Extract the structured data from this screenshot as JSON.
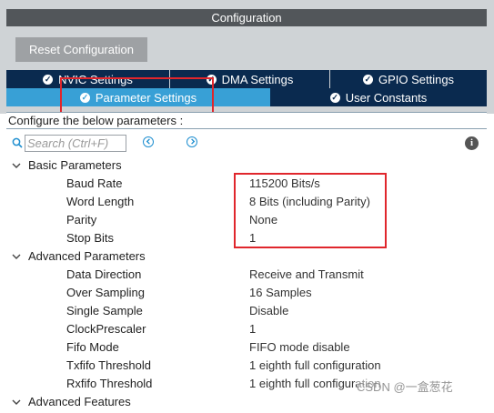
{
  "window": {
    "title": "Configuration"
  },
  "toolbar": {
    "reset_label": "Reset Configuration"
  },
  "tabs_row1": [
    {
      "label": "NVIC Settings",
      "icon": "check-circle-icon"
    },
    {
      "label": "DMA Settings",
      "icon": "check-circle-icon"
    },
    {
      "label": "GPIO Settings",
      "icon": "check-circle-icon"
    }
  ],
  "tabs_row2": [
    {
      "label": "Parameter Settings",
      "icon": "check-circle-icon",
      "active": true
    },
    {
      "label": "User Constants",
      "icon": "check-circle-icon",
      "active": false
    }
  ],
  "subtitle": "Configure the below parameters :",
  "search": {
    "placeholder": "Search (Ctrl+F)",
    "value": ""
  },
  "groups": [
    {
      "label": "Basic Parameters",
      "expanded": true,
      "params": [
        {
          "name": "Baud Rate",
          "value": "115200 Bits/s"
        },
        {
          "name": "Word Length",
          "value": "8 Bits (including Parity)"
        },
        {
          "name": "Parity",
          "value": "None"
        },
        {
          "name": "Stop Bits",
          "value": "1"
        }
      ]
    },
    {
      "label": "Advanced Parameters",
      "expanded": true,
      "params": [
        {
          "name": "Data Direction",
          "value": "Receive and Transmit"
        },
        {
          "name": "Over Sampling",
          "value": "16 Samples"
        },
        {
          "name": "Single Sample",
          "value": "Disable"
        },
        {
          "name": "ClockPrescaler",
          "value": "1"
        },
        {
          "name": "Fifo Mode",
          "value": "FIFO mode disable"
        },
        {
          "name": "Txfifo Threshold",
          "value": "1 eighth full configuration"
        },
        {
          "name": "Rxfifo Threshold",
          "value": "1 eighth full configuration"
        }
      ]
    },
    {
      "label": "Advanced Features",
      "expanded": false,
      "params": []
    }
  ],
  "watermark": "CSDN @一盒葱花",
  "colors": {
    "title_bar": "#52565a",
    "tab_dark": "#0a2a4f",
    "tab_active": "#38a0d6",
    "highlight": "#e0262c",
    "nav_accent": "#1f8fd0"
  }
}
